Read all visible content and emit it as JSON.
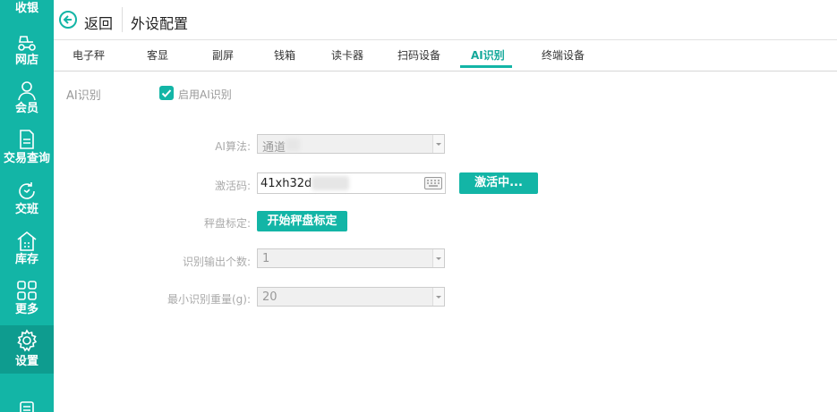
{
  "sidebar": {
    "top_label": "收银",
    "items": [
      {
        "label": "网店",
        "icon": "scooter-icon"
      },
      {
        "label": "会员",
        "icon": "user-icon"
      },
      {
        "label": "交易查询",
        "icon": "document-icon"
      },
      {
        "label": "交班",
        "icon": "shift-icon"
      },
      {
        "label": "库存",
        "icon": "warehouse-icon"
      },
      {
        "label": "更多",
        "icon": "grid-icon"
      },
      {
        "label": "设置",
        "icon": "gear-icon"
      }
    ]
  },
  "header": {
    "back_label": "返回",
    "title": "外设配置"
  },
  "tabs": [
    {
      "label": "电子秤"
    },
    {
      "label": "客显"
    },
    {
      "label": "副屏"
    },
    {
      "label": "钱箱"
    },
    {
      "label": "读卡器"
    },
    {
      "label": "扫码设备"
    },
    {
      "label": "AI识别",
      "active": true
    },
    {
      "label": "终端设备"
    }
  ],
  "ai": {
    "section_title": "AI识别",
    "enable_label": "启用AI识别",
    "enabled": true,
    "algorithm_label": "AI算法:",
    "algorithm_value": "通道",
    "activation_label": "激活码:",
    "activation_value": "41xh32d",
    "activate_button": "激活中...",
    "calibration_label": "秤盘标定:",
    "calibration_button": "开始秤盘标定",
    "output_count_label": "识别输出个数:",
    "output_count_value": "1",
    "min_weight_label": "最小识别重量(g):",
    "min_weight_value": "20"
  },
  "colors": {
    "accent": "#13b5a6",
    "accent_dark": "#0e9c8f"
  }
}
